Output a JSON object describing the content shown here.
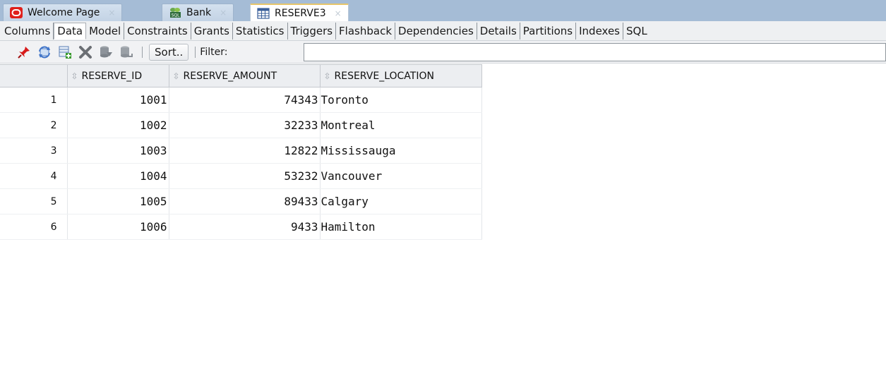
{
  "tabs": [
    {
      "label": "Welcome Page",
      "icon": "oracle-logo-icon",
      "active": false
    },
    {
      "label": "Bank",
      "icon": "sql-connection-icon",
      "active": false
    },
    {
      "label": "RESERVE3",
      "icon": "table-grid-icon",
      "active": true
    }
  ],
  "tab_close_glyph": "×",
  "subtabs": [
    "Columns",
    "Data",
    "Model",
    "Constraints",
    "Grants",
    "Statistics",
    "Triggers",
    "Flashback",
    "Dependencies",
    "Details",
    "Partitions",
    "Indexes",
    "SQL"
  ],
  "active_subtab": "Data",
  "toolbar": {
    "icons": [
      "pin-icon",
      "refresh-icon",
      "insert-row-icon",
      "delete-row-icon",
      "commit-icon",
      "rollback-icon"
    ],
    "sort_label": "Sort..",
    "filter_label": "Filter:",
    "filter_value": ""
  },
  "grid": {
    "columns": [
      "RESERVE_ID",
      "RESERVE_AMOUNT",
      "RESERVE_LOCATION"
    ],
    "rows": [
      {
        "n": "1",
        "id": "1001",
        "amount": "74343",
        "location": "Toronto"
      },
      {
        "n": "2",
        "id": "1002",
        "amount": "32233",
        "location": "Montreal"
      },
      {
        "n": "3",
        "id": "1003",
        "amount": "12822",
        "location": "Mississauga"
      },
      {
        "n": "4",
        "id": "1004",
        "amount": "53232",
        "location": "Vancouver"
      },
      {
        "n": "5",
        "id": "1005",
        "amount": "89433",
        "location": "Calgary"
      },
      {
        "n": "6",
        "id": "1006",
        "amount": "9433",
        "location": "Hamilton"
      }
    ]
  },
  "colors": {
    "tabstrip": "#a5bcd6",
    "active_tab_accent": "#e7c56a",
    "oracle_red": "#e0201b"
  }
}
